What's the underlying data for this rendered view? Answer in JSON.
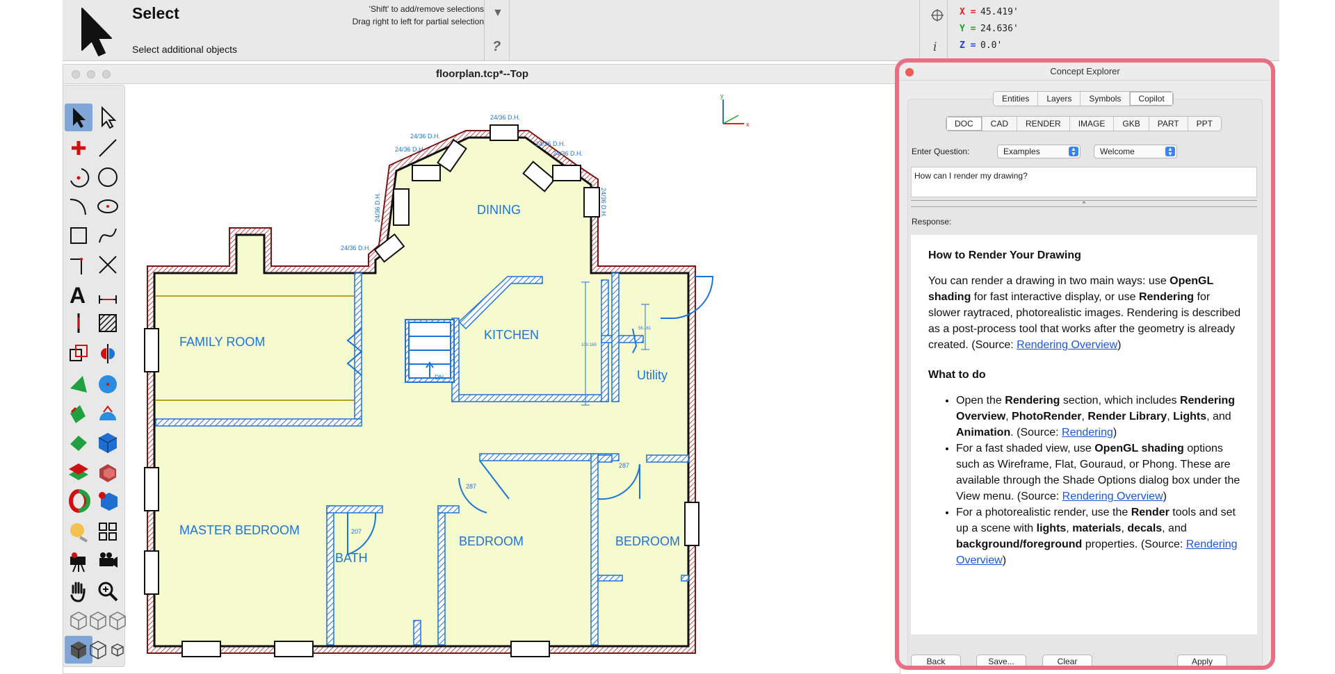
{
  "toolbar": {
    "title": "Select",
    "hint": "Select additional objects",
    "tip_line1": "'Shift' to add/remove selections",
    "tip_line2": "Drag right to left for partial selection",
    "help": "?",
    "coords": {
      "x_label": "X =",
      "x": "45.419'",
      "y_label": "Y =",
      "y": "24.636'",
      "z_label": "Z =",
      "z": "0.0'"
    },
    "info": "i"
  },
  "drawing": {
    "title": "floorplan.tcp*--Top",
    "rooms": {
      "family": "FAMILY ROOM",
      "dining": "DINING",
      "kitchen": "KITCHEN",
      "utility": "Utility",
      "master": "MASTER BEDROOM",
      "bath": "BATH",
      "bedroom1": "BEDROOM",
      "bedroom2": "BEDROOM"
    },
    "window_label": "24/36 D.H.",
    "door_207": "207",
    "door_287a": "287",
    "door_287b": "287",
    "stair_dn": "DN",
    "dim_kitchen": "100.165",
    "dim_utility": "56.161",
    "axis_x": "x",
    "axis_y": "y"
  },
  "explorer": {
    "title": "Concept Explorer",
    "tabs1": [
      "Entities",
      "Layers",
      "Symbols",
      "Copilot"
    ],
    "tabs1_active": "Copilot",
    "tabs2": [
      "DOC",
      "CAD",
      "RENDER",
      "IMAGE",
      "GKB",
      "PART",
      "PPT"
    ],
    "tabs2_active": "DOC",
    "enter_question": "Enter Question:",
    "examples": "Examples",
    "welcome": "Welcome",
    "question": "How can I render my drawing?",
    "response_label": "Response:",
    "response": {
      "heading": "How to Render Your Drawing",
      "p1_a": "You can render a drawing in two main ways: use ",
      "p1_b": "OpenGL shading",
      "p1_c": " for fast interactive display, or use ",
      "p1_d": "Rendering",
      "p1_e": " for slower raytraced, photorealistic images. Rendering is described as a post-process tool that works after the geometry is already created. (Source: ",
      "p1_link": "Rendering Overview",
      "p1_f": ")",
      "what_to_do": "What to do",
      "li1_a": "Open the ",
      "li1_b": "Rendering",
      "li1_c": " section, which includes ",
      "li1_d": "Rendering Overview",
      "li1_e": ", ",
      "li1_f": "PhotoRender",
      "li1_g": ", ",
      "li1_h": "Render Library",
      "li1_i": ", ",
      "li1_j": "Lights",
      "li1_k": ", and ",
      "li1_l": "Animation",
      "li1_m": ". (Source: ",
      "li1_link": "Rendering",
      "li1_n": ")",
      "li2_a": "For a fast shaded view, use ",
      "li2_b": "OpenGL shading",
      "li2_c": " options such as Wireframe, Flat, Gouraud, or Phong. These are available through the Shade Options dialog box under the View menu. (Source: ",
      "li2_link": "Rendering Overview",
      "li2_d": ")",
      "li3_a": "For a photorealistic render, use the ",
      "li3_b": "Render",
      "li3_c": " tools and set up a scene with ",
      "li3_d": "lights",
      "li3_e": ", ",
      "li3_f": "materials",
      "li3_g": ", ",
      "li3_h": "decals",
      "li3_i": ", and ",
      "li3_j": "background/foreground",
      "li3_k": " properties. (Source: ",
      "li3_link": "Rendering Overview",
      "li3_l": ")"
    },
    "buttons": {
      "back": "Back",
      "save": "Save...",
      "clear": "Clear",
      "apply": "Apply"
    }
  },
  "colors": {
    "accent_border": "#ea6e83",
    "plan_fill": "#f6fbcf",
    "plan_blue": "#1e73d8",
    "wall_red": "#b02020"
  }
}
